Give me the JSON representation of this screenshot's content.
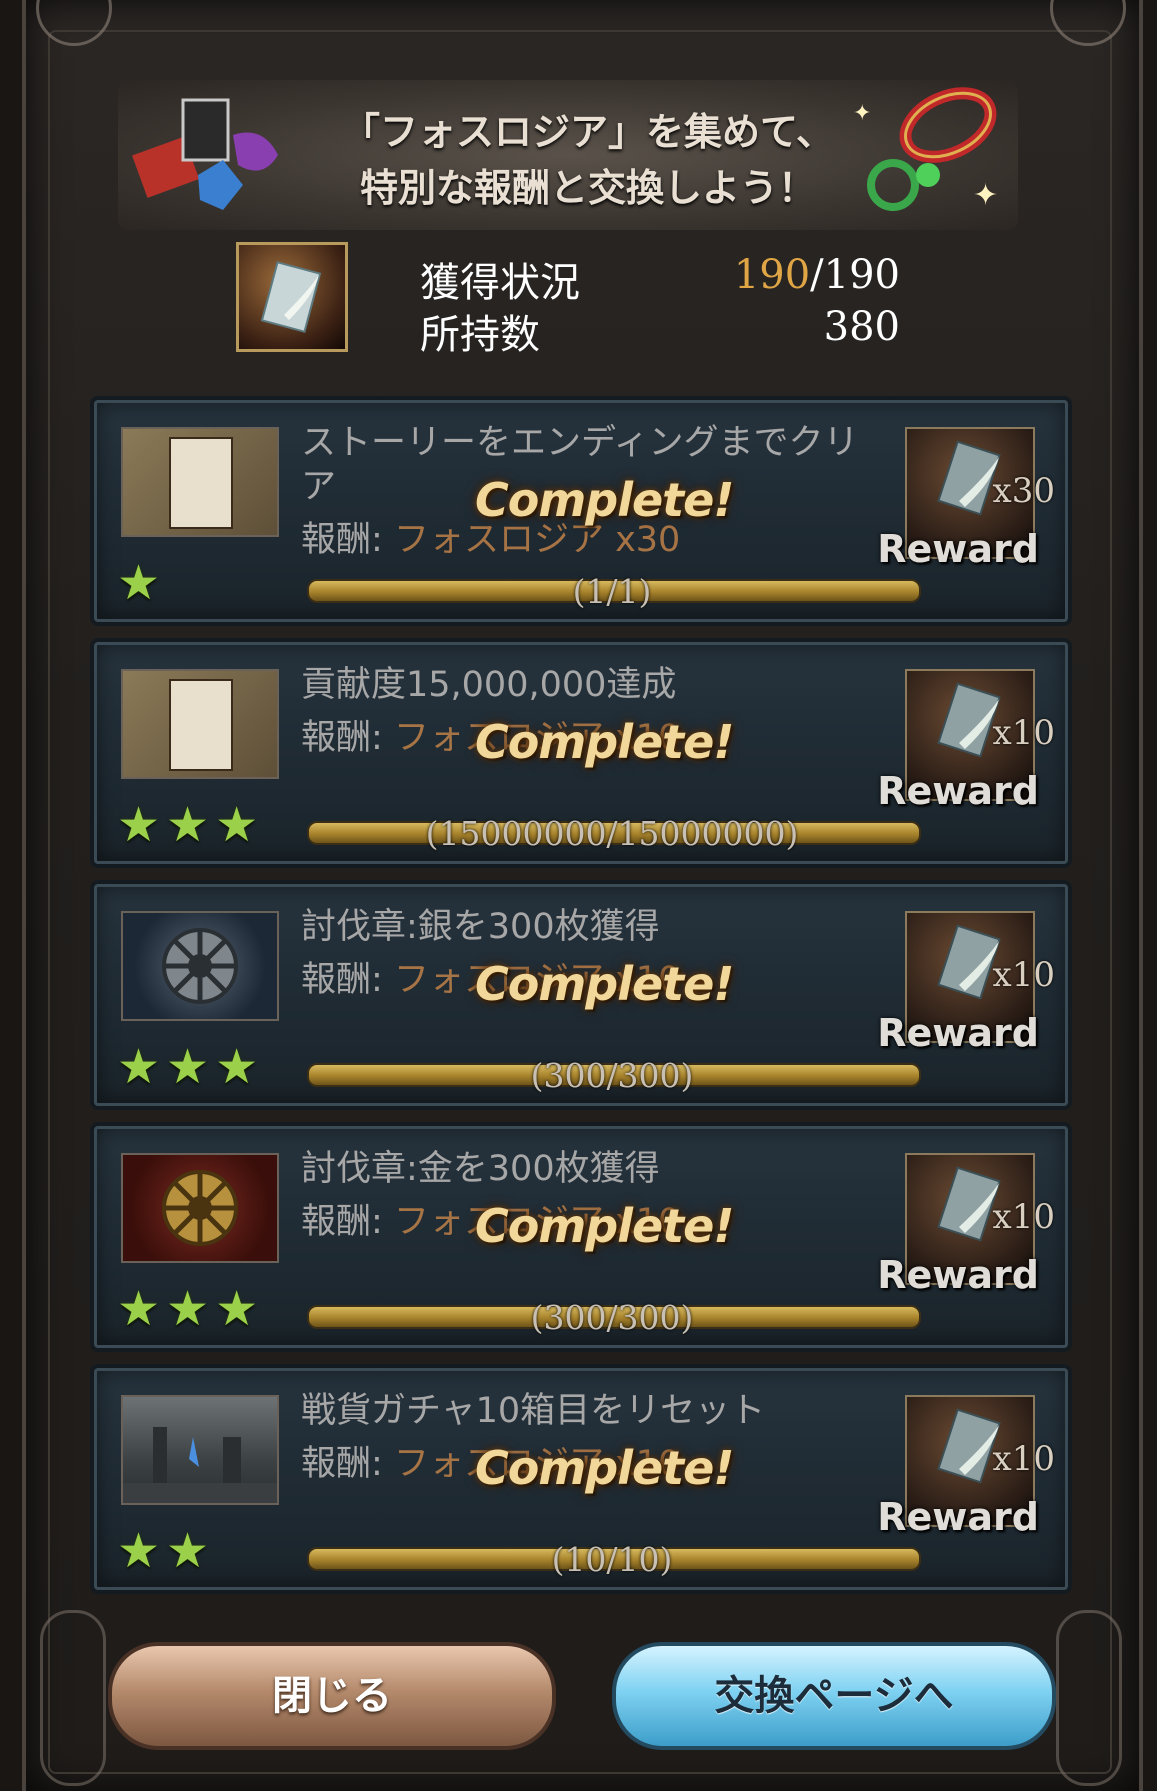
{
  "banner": {
    "line1": "「フォスロジア」を集めて、",
    "line2": "特別な報酬と交換しよう！"
  },
  "status": {
    "acquired_label": "獲得状況",
    "acquired_current": "190",
    "acquired_total": "/190",
    "owned_label": "所持数",
    "owned_value": "380"
  },
  "missions": [
    {
      "title": "ストーリーをエンディングまでクリア",
      "reward_prefix": "報酬:",
      "reward_name": "フォスロジア x30",
      "complete": "Complete!",
      "progress": "(1/1)",
      "progress_fraction": 1.0,
      "stars": "★",
      "reward_qty": "x30",
      "reward_label": "Reward"
    },
    {
      "title": "貢献度15,000,000達成",
      "reward_prefix": "報酬:",
      "reward_name": "フォスロジア x10",
      "complete": "Complete!",
      "progress": "(15000000/15000000)",
      "progress_fraction": 1.0,
      "stars": "★★★",
      "reward_qty": "x10",
      "reward_label": "Reward"
    },
    {
      "title": "討伐章:銀を300枚獲得",
      "reward_prefix": "報酬:",
      "reward_name": "フォスロジア x10",
      "complete": "Complete!",
      "progress": "(300/300)",
      "progress_fraction": 1.0,
      "stars": "★★★",
      "reward_qty": "x10",
      "reward_label": "Reward"
    },
    {
      "title": "討伐章:金を300枚獲得",
      "reward_prefix": "報酬:",
      "reward_name": "フォスロジア x10",
      "complete": "Complete!",
      "progress": "(300/300)",
      "progress_fraction": 1.0,
      "stars": "★★★",
      "reward_qty": "x10",
      "reward_label": "Reward"
    },
    {
      "title": "戦貨ガチャ10箱目をリセット",
      "reward_prefix": "報酬:",
      "reward_name": "フォスロジア x10",
      "complete": "Complete!",
      "progress": "(10/10)",
      "progress_fraction": 1.0,
      "stars": "★★",
      "reward_qty": "x10",
      "reward_label": "Reward"
    }
  ],
  "buttons": {
    "close": "閉じる",
    "exchange": "交換ページへ"
  }
}
